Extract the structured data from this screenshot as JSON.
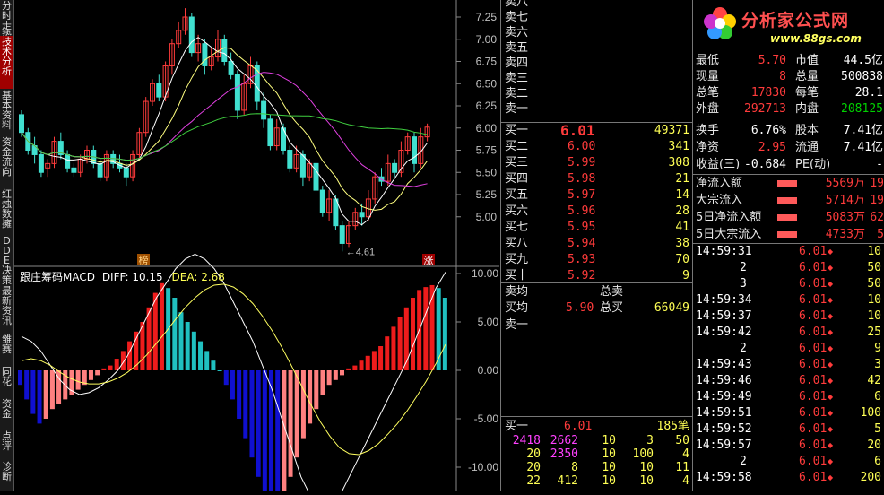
{
  "sidebar": {
    "tabs": [
      {
        "label": "分时走势",
        "active": false
      },
      {
        "label": "技术分析",
        "active": true
      },
      {
        "label": "基本资料",
        "active": false
      },
      {
        "label": "资金流向",
        "active": false
      },
      {
        "label": "红烛数擁",
        "active": false
      },
      {
        "label": "DDE决策",
        "active": false
      },
      {
        "label": "最新资讯",
        "active": false
      },
      {
        "label": "雏赛",
        "active": false
      },
      {
        "label": "同花",
        "active": false
      },
      {
        "label": "资金",
        "active": false
      },
      {
        "label": "点评",
        "active": false
      },
      {
        "label": "诊断",
        "active": false
      }
    ]
  },
  "price_chart": {
    "y_ticks": [
      "7.25",
      "7.00",
      "6.75",
      "6.50",
      "6.25",
      "6.00",
      "5.75",
      "5.50",
      "5.25",
      "5.00"
    ],
    "low_marker": "4.61",
    "markers": [
      "榜",
      "涨"
    ]
  },
  "macd": {
    "title": "跟庄筹码MACD",
    "diff_label": "DIFF: 10.15",
    "dea_label": "DEA: 2.68",
    "y_ticks": [
      "10.00",
      "5.00",
      "0.00",
      "-5.00",
      "-10.00"
    ]
  },
  "order_book": {
    "sell_labels": [
      "卖八",
      "卖七",
      "卖六",
      "卖五",
      "卖四",
      "卖三",
      "卖二",
      "卖一"
    ],
    "buy": [
      {
        "label": "买一",
        "price": "6.01",
        "vol": "49371"
      },
      {
        "label": "买二",
        "price": "6.00",
        "vol": "341"
      },
      {
        "label": "买三",
        "price": "5.99",
        "vol": "308"
      },
      {
        "label": "买四",
        "price": "5.98",
        "vol": "21"
      },
      {
        "label": "买五",
        "price": "5.97",
        "vol": "14"
      },
      {
        "label": "买六",
        "price": "5.96",
        "vol": "28"
      },
      {
        "label": "买七",
        "price": "5.95",
        "vol": "41"
      },
      {
        "label": "买八",
        "price": "5.94",
        "vol": "38"
      },
      {
        "label": "买九",
        "price": "5.93",
        "vol": "70"
      },
      {
        "label": "买十",
        "price": "5.92",
        "vol": "9"
      }
    ],
    "avg_sell_label": "卖均",
    "total_sell_label": "总卖",
    "avg_buy_label": "买均",
    "avg_buy_price": "5.90",
    "total_buy_label": "总买",
    "total_buy_value": "66049",
    "sell_one_label": "卖一",
    "queue_header": {
      "label": "买一",
      "price": "6.01",
      "count": "185笔"
    },
    "queue_rows": [
      [
        "2418",
        "2662",
        "10",
        "3",
        "50"
      ],
      [
        "20",
        "2350",
        "10",
        "100",
        "4"
      ],
      [
        "20",
        "8",
        "10",
        "10",
        "11"
      ],
      [
        "22",
        "412",
        "10",
        "10",
        "4"
      ]
    ]
  },
  "stock_info": {
    "logo_text": "分析家公式网",
    "logo_url": "www.88gs.com",
    "stats": [
      {
        "l1": "最低",
        "v1": "5.70",
        "l2": "市值",
        "v2": "44.5亿"
      },
      {
        "l1": "现量",
        "v1": "8",
        "l2": "总量",
        "v2": "500838"
      },
      {
        "l1": "总笔",
        "v1": "17830",
        "l2": "每笔",
        "v2": "28.1"
      },
      {
        "l1": "外盘",
        "v1": "292713",
        "l2": "内盘",
        "v2": "208125"
      },
      {
        "l1": "换手",
        "v1": "6.76%",
        "l2": "股本",
        "v2": "7.41亿"
      },
      {
        "l1": "净资",
        "v1": "2.95",
        "l2": "流通",
        "v2": "7.41亿"
      },
      {
        "l1": "收益(三)",
        "v1": "-0.684",
        "l2": "PE(动)",
        "v2": "-"
      }
    ],
    "flows": [
      {
        "label": "净流入额",
        "value": "5569万",
        "extra": "19"
      },
      {
        "label": "大宗流入",
        "value": "5714万",
        "extra": "19"
      },
      {
        "label": "5日净流入额",
        "value": "5083万",
        "extra": "62"
      },
      {
        "label": "5日大宗流入",
        "value": "4733万",
        "extra": "5"
      }
    ],
    "ticks": [
      {
        "time": "14:59:31",
        "price": "6.01",
        "vol": "10"
      },
      {
        "time": "2",
        "price": "6.01",
        "vol": "50"
      },
      {
        "time": "3",
        "price": "6.01",
        "vol": "50"
      },
      {
        "time": "14:59:34",
        "price": "6.01",
        "vol": "10"
      },
      {
        "time": "14:59:37",
        "price": "6.01",
        "vol": "10"
      },
      {
        "time": "14:59:42",
        "price": "6.01",
        "vol": "25"
      },
      {
        "time": "2",
        "price": "6.01",
        "vol": "9"
      },
      {
        "time": "14:59:43",
        "price": "6.01",
        "vol": "3"
      },
      {
        "time": "14:59:46",
        "price": "6.01",
        "vol": "42"
      },
      {
        "time": "14:59:49",
        "price": "6.01",
        "vol": "6"
      },
      {
        "time": "14:59:51",
        "price": "6.01",
        "vol": "100"
      },
      {
        "time": "14:59:52",
        "price": "6.01",
        "vol": "5"
      },
      {
        "time": "14:59:57",
        "price": "6.01",
        "vol": "20"
      },
      {
        "time": "2",
        "price": "6.01",
        "vol": "6"
      },
      {
        "time": "14:59:58",
        "price": "6.01",
        "vol": "200"
      }
    ]
  },
  "colors": {
    "up": "#ff3b3b",
    "down": "#40e0d0",
    "ma_white": "#ffffff",
    "ma_yellow": "#ffff80",
    "ma_magenta": "#e040e0",
    "ma_green": "#40d040"
  }
}
